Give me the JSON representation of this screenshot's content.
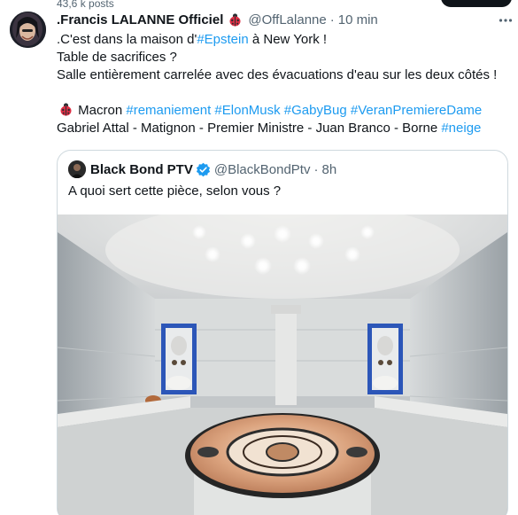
{
  "header": {
    "posts_count": "43,6 k posts"
  },
  "tweet": {
    "author_name": ".Francis LALANNE Officiel",
    "handle": "@OffLalanne",
    "separator": "·",
    "time": "10 min",
    "line1": {
      "prefix": ".C'est dans la maison d'",
      "tag": "#Epstein",
      "suffix": " à New York !"
    },
    "line2": "Table de sacrifices ?",
    "line3": "Salle entièrement carrelée avec des évacuations d'eau sur les deux côtés !",
    "line5": {
      "prefix": " Macron ",
      "tags": [
        "#remaniement",
        "#ElonMusk",
        "#GabyBug",
        "#VeranPremiereDame"
      ]
    },
    "line6": {
      "prefix": "Gabriel Attal - Matignon - Premier Ministre - Juan Branco - Borne ",
      "tag": "#neige"
    }
  },
  "quote": {
    "author_name": "Black Bond PTV",
    "handle": "@BlackBondPtv",
    "separator": "·",
    "time": "8h",
    "text": "A quoi sert cette pièce, selon vous ?"
  },
  "icons": {
    "name_emoji": "ladybug-icon",
    "verified": "verified-badge-icon",
    "more": "more-options-icon"
  },
  "colors": {
    "link": "#1d9bf0",
    "muted": "#536471",
    "text": "#0f1419",
    "border": "#cfd9de"
  }
}
